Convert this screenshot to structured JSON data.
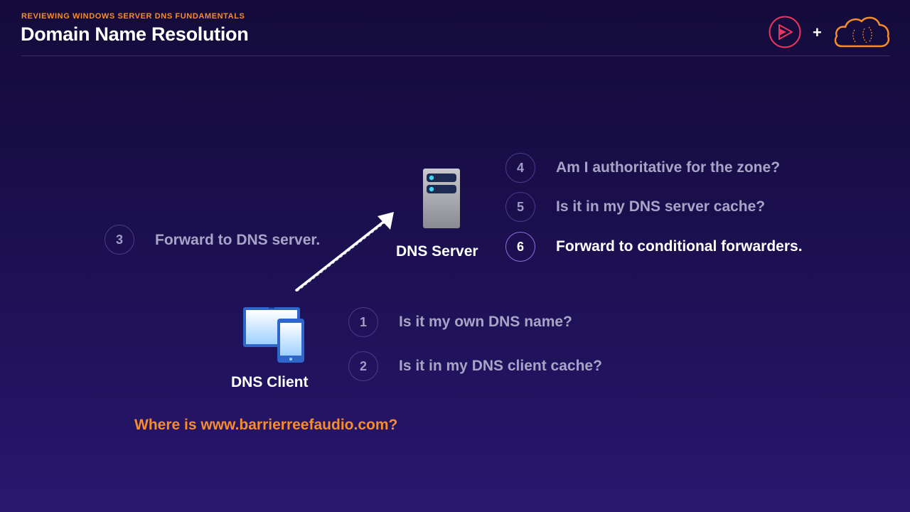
{
  "header": {
    "kicker": "REVIEWING WINDOWS SERVER DNS FUNDAMENTALS",
    "title": "Domain Name Resolution",
    "plus": "+"
  },
  "diagram": {
    "server_label": "DNS Server",
    "client_label": "DNS Client",
    "question": "Where is www.barrierreefaudio.com?",
    "steps": [
      {
        "num": "1",
        "text": "Is it my own DNS name?"
      },
      {
        "num": "2",
        "text": "Is it in my DNS client cache?"
      },
      {
        "num": "3",
        "text": "Forward to DNS server."
      },
      {
        "num": "4",
        "text": "Am I authoritative for the zone?"
      },
      {
        "num": "5",
        "text": "Is it in my DNS server cache?"
      },
      {
        "num": "6",
        "text": "Forward to conditional forwarders."
      }
    ],
    "active_step": "6"
  },
  "colors": {
    "accent_orange": "#f68c2e",
    "logo_pink": "#e8365d",
    "background": "#1a0f4c"
  },
  "icons": [
    "play-logo-icon",
    "cloud-logo-icon",
    "server-icon",
    "devices-icon",
    "arrow-icon"
  ]
}
